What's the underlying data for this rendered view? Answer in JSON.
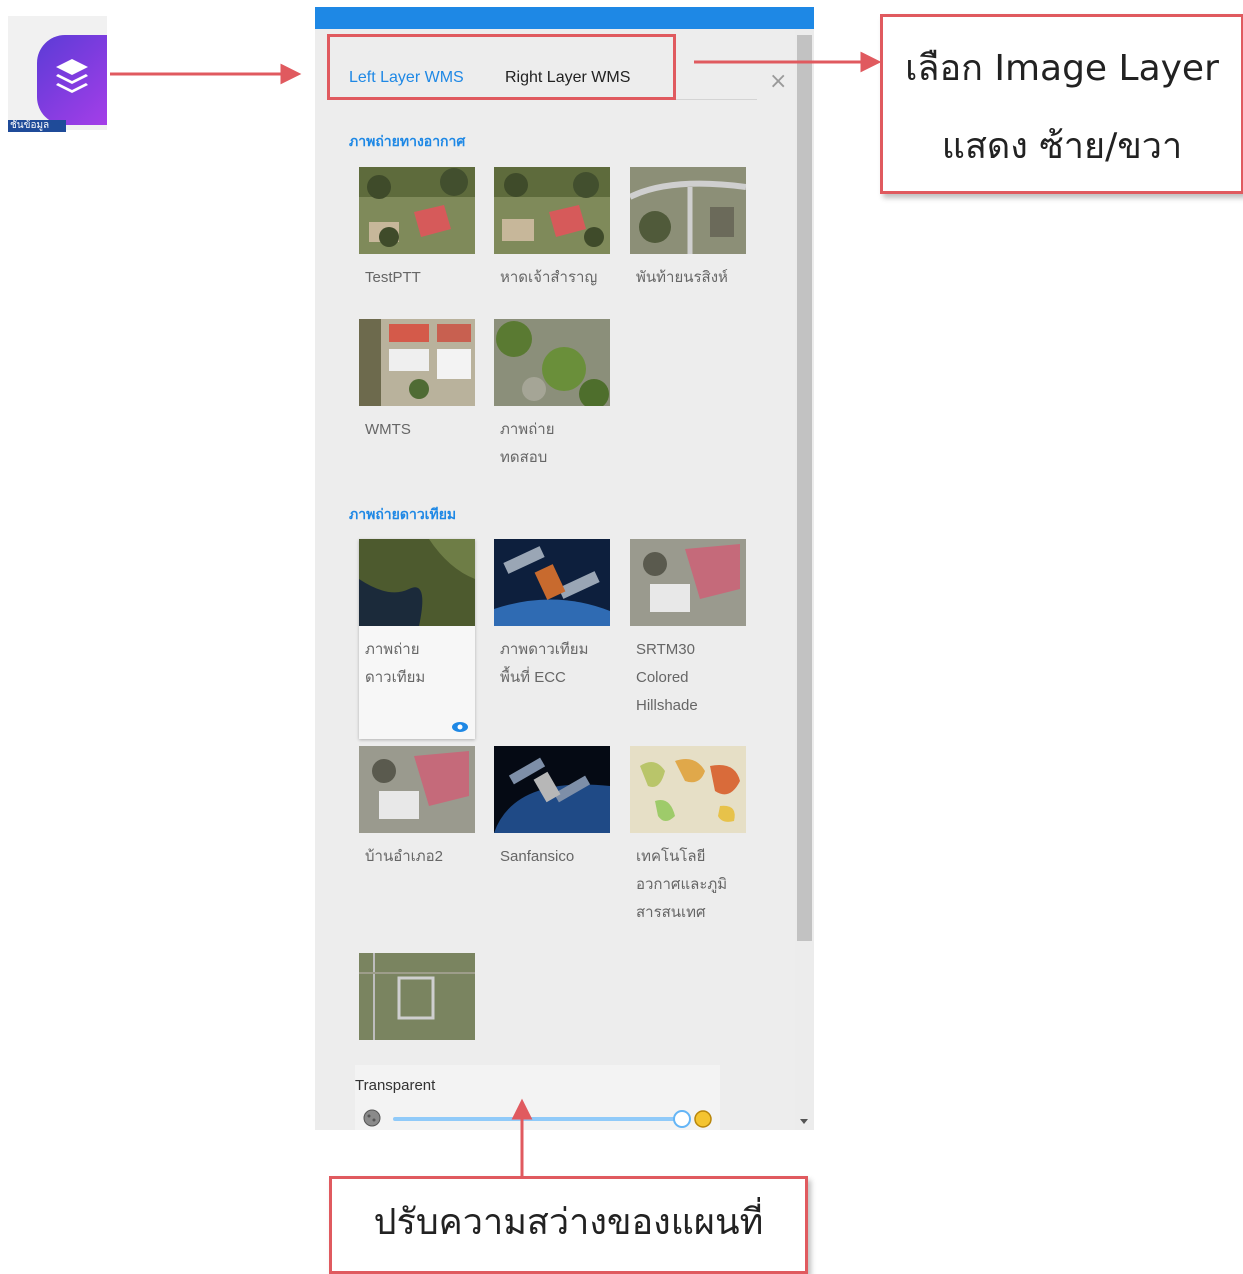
{
  "layer_button": {
    "caption": "ชั้นข้อมูล",
    "icon": "layers-icon"
  },
  "panel": {
    "tabs": [
      {
        "label": "Left Layer WMS",
        "active": true
      },
      {
        "label": "Right Layer WMS",
        "active": false
      }
    ],
    "close_label": "×",
    "sections": [
      {
        "title": "ภาพถ่ายทางอากาศ",
        "items": [
          {
            "label": "TestPTT"
          },
          {
            "label": "หาดเจ้าสำราญ"
          },
          {
            "label": "พันท้ายนรสิงห์"
          },
          {
            "label": "WMTS"
          },
          {
            "label": "ภาพถ่าย\nทดสอบ"
          }
        ]
      },
      {
        "title": "ภาพถ่ายดาวเทียม",
        "items": [
          {
            "label": "ภาพถ่าย\nดาวเทียม",
            "selected": true,
            "visible": true
          },
          {
            "label": "ภาพดาวเทียม\nพื้นที่ ECC"
          },
          {
            "label": "SRTM30\nColored\nHillshade"
          },
          {
            "label": "บ้านอำเภอ2"
          },
          {
            "label": "Sanfansico"
          },
          {
            "label": "เทคโนโลยี\nอวกาศและภูมิ\nสารสนเทศ"
          },
          {
            "label": ""
          }
        ]
      }
    ],
    "transparency": {
      "label": "Transparent",
      "value": 1.0
    }
  },
  "annotations": {
    "tabs_callout_line1": "เลือก Image Layer",
    "tabs_callout_line2": "แสดง ซ้าย/ขวา",
    "slider_callout": "ปรับความสว่างของแผนที่"
  },
  "colors": {
    "accent": "#1e88e5",
    "annotation": "#e05a5f",
    "button_gradient_start": "#5b3bd6",
    "button_gradient_end": "#a43ee8"
  }
}
